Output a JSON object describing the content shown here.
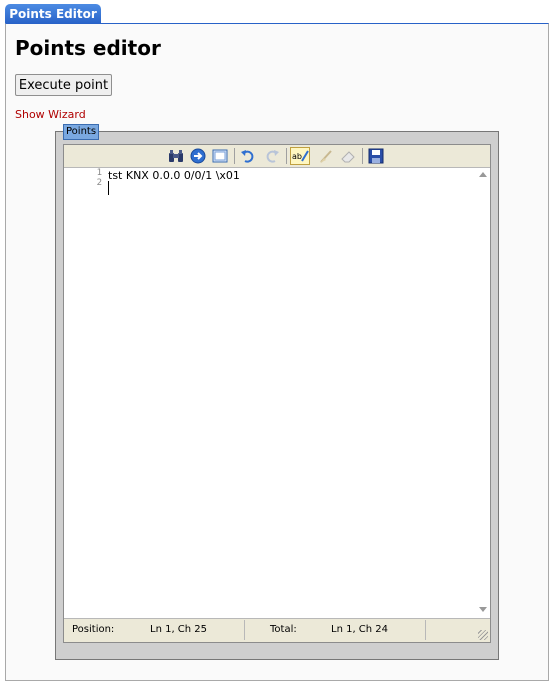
{
  "tab": {
    "label": "Points Editor"
  },
  "page": {
    "title": "Points editor"
  },
  "actions": {
    "execute_label": "Execute point",
    "wizard_link": "Show Wizard"
  },
  "points": {
    "legend": "Points",
    "toolbar": {
      "icons": [
        "find-icon",
        "goto-icon",
        "fullscreen-icon",
        "undo-icon",
        "redo-icon",
        "highlight-icon",
        "reset-highlight-icon",
        "eraser-icon",
        "save-icon"
      ]
    },
    "editor": {
      "line_numbers": [
        "1",
        "2"
      ],
      "content": "tst KNX 0.0.0 0/0/1 \\x01"
    },
    "status": {
      "position_label": "Position:",
      "position_value": "Ln 1, Ch 25",
      "total_label": "Total:",
      "total_value": "Ln 1, Ch 24"
    }
  },
  "colors": {
    "tab_blue": "#2862c8",
    "wizard_link": "#b00000",
    "legend_bg": "#7aa8e0"
  }
}
